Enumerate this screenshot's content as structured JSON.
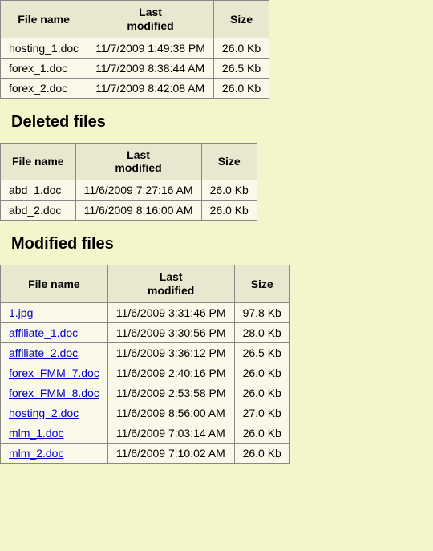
{
  "headers": {
    "filename": "File name",
    "last_modified": "Last modified",
    "size": "Size"
  },
  "sections": {
    "deleted_heading": "Deleted files",
    "modified_heading": "Modified files"
  },
  "table1": {
    "rows": [
      {
        "name": "hosting_1.doc",
        "modified": "11/7/2009 1:49:38 PM",
        "size": "26.0 Kb"
      },
      {
        "name": "forex_1.doc",
        "modified": "11/7/2009 8:38:44 AM",
        "size": "26.5 Kb"
      },
      {
        "name": "forex_2.doc",
        "modified": "11/7/2009 8:42:08 AM",
        "size": "26.0 Kb"
      }
    ]
  },
  "table2": {
    "rows": [
      {
        "name": "abd_1.doc",
        "modified": "11/6/2009 7:27:16 AM",
        "size": "26.0 Kb"
      },
      {
        "name": "abd_2.doc",
        "modified": "11/6/2009 8:16:00 AM",
        "size": "26.0 Kb"
      }
    ]
  },
  "table3": {
    "rows": [
      {
        "name": "1.jpg",
        "modified": "11/6/2009 3:31:46 PM",
        "size": "97.8 Kb"
      },
      {
        "name": "affiliate_1.doc",
        "modified": "11/6/2009 3:30:56 PM",
        "size": "28.0 Kb"
      },
      {
        "name": "affiliate_2.doc",
        "modified": "11/6/2009 3:36:12 PM",
        "size": "26.5 Kb"
      },
      {
        "name": "forex_FMM_7.doc",
        "modified": "11/6/2009 2:40:16 PM",
        "size": "26.0 Kb"
      },
      {
        "name": "forex_FMM_8.doc",
        "modified": "11/6/2009 2:53:58 PM",
        "size": "26.0 Kb"
      },
      {
        "name": "hosting_2.doc",
        "modified": "11/6/2009 8:56:00 AM",
        "size": "27.0 Kb"
      },
      {
        "name": "mlm_1.doc",
        "modified": "11/6/2009 7:03:14 AM",
        "size": "26.0 Kb"
      },
      {
        "name": "mlm_2.doc",
        "modified": "11/6/2009 7:10:02 AM",
        "size": "26.0 Kb"
      }
    ]
  }
}
